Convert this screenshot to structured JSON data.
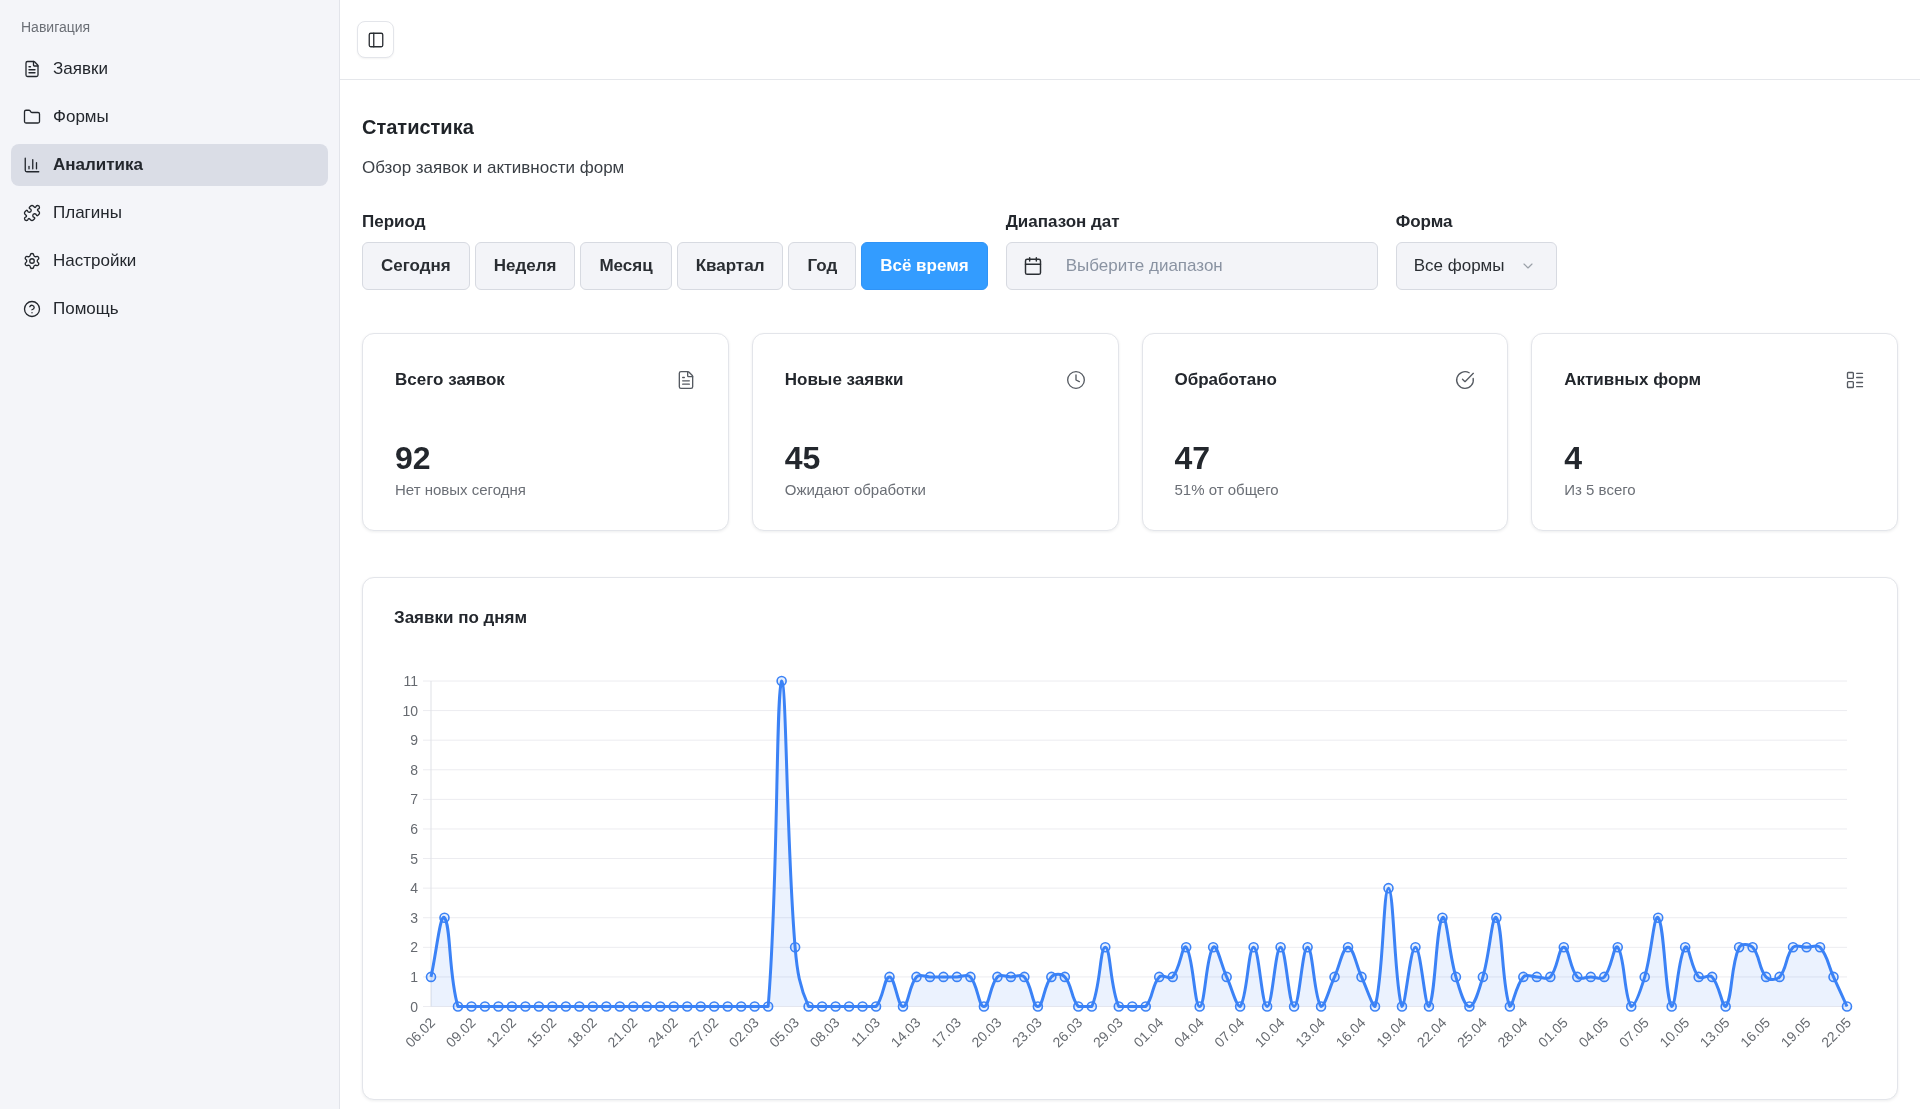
{
  "sidebar": {
    "heading": "Навигация",
    "items": [
      {
        "label": "Заявки",
        "selected": false
      },
      {
        "label": "Формы",
        "selected": false
      },
      {
        "label": "Аналитика",
        "selected": true
      },
      {
        "label": "Плагины",
        "selected": false
      },
      {
        "label": "Настройки",
        "selected": false
      },
      {
        "label": "Помощь",
        "selected": false
      }
    ]
  },
  "page": {
    "title": "Статистика",
    "subtitle": "Обзор заявок и активности форм"
  },
  "filters": {
    "period": {
      "label": "Период",
      "options": [
        {
          "label": "Сегодня",
          "selected": false
        },
        {
          "label": "Неделя",
          "selected": false
        },
        {
          "label": "Месяц",
          "selected": false
        },
        {
          "label": "Квартал",
          "selected": false
        },
        {
          "label": "Год",
          "selected": false
        },
        {
          "label": "Всё время",
          "selected": true
        }
      ]
    },
    "date_range": {
      "label": "Диапазон дат",
      "placeholder": "Выберите диапазон"
    },
    "form": {
      "label": "Форма",
      "value": "Все формы"
    }
  },
  "stats": [
    {
      "title": "Всего заявок",
      "value": "92",
      "note": "Нет новых сегодня"
    },
    {
      "title": "Новые заявки",
      "value": "45",
      "note": "Ожидают обработки"
    },
    {
      "title": "Обработано",
      "value": "47",
      "note": "51% от общего"
    },
    {
      "title": "Активных форм",
      "value": "4",
      "note": "Из 5 всего"
    }
  ],
  "chart_panel": {
    "chart_data": {
      "type": "area",
      "title": "Заявки по дням",
      "grid": true,
      "ylim": [
        0,
        11
      ],
      "yticks": [
        0,
        1,
        2,
        3,
        4,
        5,
        6,
        7,
        8,
        9,
        10,
        11
      ],
      "categories": [
        "06.02",
        null,
        null,
        "09.02",
        null,
        null,
        "12.02",
        null,
        null,
        "15.02",
        null,
        null,
        "18.02",
        null,
        null,
        "21.02",
        null,
        null,
        "24.02",
        null,
        null,
        "27.02",
        null,
        null,
        "02.03",
        null,
        null,
        "05.03",
        null,
        null,
        "08.03",
        null,
        null,
        "11.03",
        null,
        null,
        "14.03",
        null,
        null,
        "17.03",
        null,
        null,
        "20.03",
        null,
        null,
        "23.03",
        null,
        null,
        "26.03",
        null,
        null,
        "29.03",
        null,
        null,
        "01.04",
        null,
        null,
        "04.04",
        null,
        null,
        "07.04",
        null,
        null,
        "10.04",
        null,
        null,
        "13.04",
        null,
        null,
        "16.04",
        null,
        null,
        "19.04",
        null,
        null,
        "22.04",
        null,
        null,
        "25.04",
        null,
        null,
        "28.04",
        null,
        null,
        "01.05",
        null,
        null,
        "04.05",
        null,
        null,
        "07.05",
        null,
        null,
        "10.05",
        null,
        null,
        "13.05",
        null,
        null,
        "16.05",
        null,
        null,
        "19.05",
        null,
        null,
        "22.05"
      ],
      "values": [
        1,
        3,
        0,
        0,
        0,
        0,
        0,
        0,
        0,
        0,
        0,
        0,
        0,
        0,
        0,
        0,
        0,
        0,
        0,
        0,
        0,
        0,
        0,
        0,
        0,
        0,
        11,
        2,
        0,
        0,
        0,
        0,
        0,
        0,
        1,
        0,
        1,
        1,
        1,
        1,
        1,
        0,
        1,
        1,
        1,
        0,
        1,
        1,
        0,
        0,
        2,
        0,
        0,
        0,
        1,
        1,
        2,
        0,
        2,
        1,
        0,
        2,
        0,
        2,
        0,
        2,
        0,
        1,
        2,
        1,
        0,
        4,
        0,
        2,
        0,
        3,
        1,
        0,
        1,
        3,
        0,
        1,
        1,
        1,
        2,
        1,
        1,
        1,
        2,
        0,
        1,
        3,
        0,
        2,
        1,
        1,
        0,
        2,
        2,
        1,
        1,
        2,
        2,
        2,
        1,
        0
      ]
    }
  }
}
